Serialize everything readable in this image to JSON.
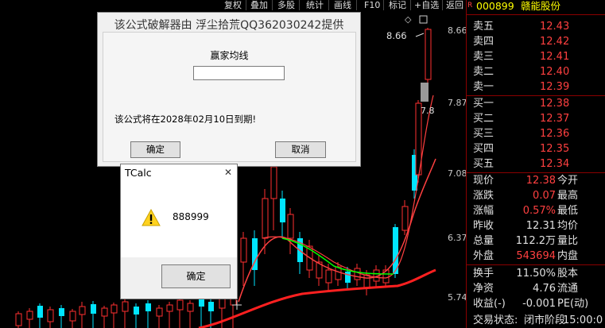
{
  "toolbar": {
    "buttons": [
      "复权",
      "叠加",
      "多股",
      "统计",
      "画线",
      "F10",
      "标记",
      "+自选",
      "返回"
    ]
  },
  "chart": {
    "price_top_label": "8.66",
    "price_mid_label": "7.8",
    "y_ticks": [
      "8.66",
      "7.87",
      "7.08",
      "6.37",
      "5.74"
    ]
  },
  "stock": {
    "code": "000899",
    "name": "赣能股份",
    "badge": "R"
  },
  "order_book": {
    "asks": [
      {
        "label": "卖五",
        "price": "12.43"
      },
      {
        "label": "卖四",
        "price": "12.42"
      },
      {
        "label": "卖三",
        "price": "12.41"
      },
      {
        "label": "卖二",
        "price": "12.40"
      },
      {
        "label": "卖一",
        "price": "12.39"
      }
    ],
    "bids": [
      {
        "label": "买一",
        "price": "12.38"
      },
      {
        "label": "买二",
        "price": "12.37"
      },
      {
        "label": "买三",
        "price": "12.36"
      },
      {
        "label": "买四",
        "price": "12.35"
      },
      {
        "label": "买五",
        "price": "12.34"
      }
    ]
  },
  "quote": {
    "rows": [
      {
        "l1": "现价",
        "v1": "12.38",
        "c1": "#ff4040",
        "l2": "今开"
      },
      {
        "l1": "涨跌",
        "v1": "0.07",
        "c1": "#ff4040",
        "l2": "最高"
      },
      {
        "l1": "涨幅",
        "v1": "0.57%",
        "c1": "#ff4040",
        "l2": "最低"
      },
      {
        "l1": "昨收",
        "v1": "12.31",
        "c1": "#e0e0e0",
        "l2": "均价"
      },
      {
        "l1": "总量",
        "v1": "112.2万",
        "c1": "#e0e0e0",
        "l2": "量比"
      },
      {
        "l1": "外盘",
        "v1": "543694",
        "c1": "#ff4040",
        "l2": "内盘"
      },
      {
        "l1": "换手",
        "v1": "11.50%",
        "c1": "#e0e0e0",
        "l2": "股本"
      },
      {
        "l1": "净资",
        "v1": "4.76",
        "c1": "#e0e0e0",
        "l2": "流通"
      },
      {
        "l1": "收益(-)",
        "v1": "-0.001",
        "c1": "#e0e0e0",
        "l2": "PE(动)"
      }
    ],
    "status_label": "交易状态:",
    "status_value": "闭市阶段",
    "status_time": "15:00:0"
  },
  "crack_dialog": {
    "title": "该公式破解器由 浮尘拾荒QQ362030242提供",
    "field_label": "赢家均线",
    "field_value": "",
    "expire_text": "该公式将在2028年02月10日到期!",
    "ok_label": "确定",
    "cancel_label": "取消"
  },
  "tcalc_dialog": {
    "title": "TCalc",
    "close_glyph": "✕",
    "message": "888999",
    "ok_label": "确定",
    "icon": "warning-icon"
  },
  "colors": {
    "up": "#ff3030",
    "down": "#00e5ff",
    "ma_fast": "#ff2020",
    "ma_mid": "#ff4040",
    "ma_green": "#00ff00",
    "panel_border": "#8b0000",
    "stock_code": "#ffff00"
  }
}
